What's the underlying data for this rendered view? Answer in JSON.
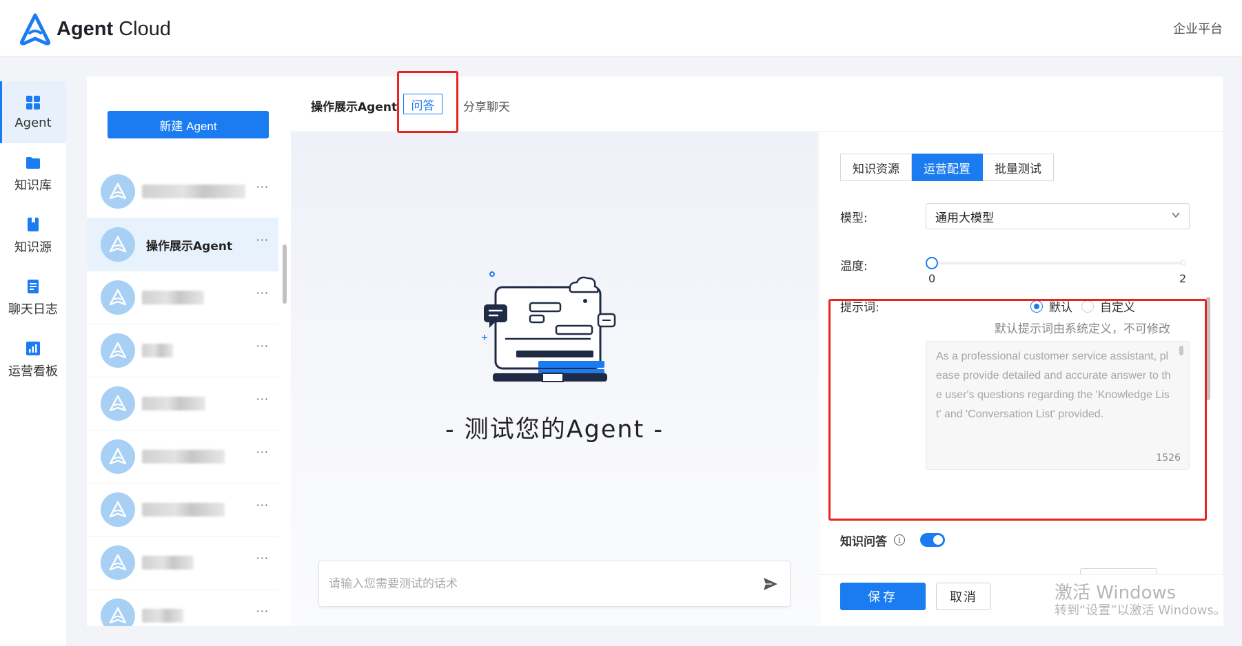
{
  "app": {
    "brand_bold": "Agent",
    "brand_light": "Cloud",
    "enterprise_label": "企业平台"
  },
  "nav": {
    "items": [
      {
        "label": "Agent",
        "icon": "grid-icon",
        "active": true
      },
      {
        "label": "知识库",
        "icon": "folder-icon"
      },
      {
        "label": "知识源",
        "icon": "book-icon"
      },
      {
        "label": "聊天日志",
        "icon": "doc-icon"
      },
      {
        "label": "运营看板",
        "icon": "chart-icon"
      }
    ]
  },
  "agent_list": {
    "new_button": "新建 Agent",
    "items": [
      {
        "name": "",
        "more": "···"
      },
      {
        "name": "操作展示Agent",
        "more": "···",
        "active": true
      },
      {
        "name": "",
        "more": "···"
      },
      {
        "name": "",
        "more": "···"
      },
      {
        "name": "",
        "more": "···"
      },
      {
        "name": "",
        "more": "···"
      },
      {
        "name": "",
        "more": "···"
      },
      {
        "name": "",
        "more": "···"
      },
      {
        "name": "",
        "more": "···"
      }
    ]
  },
  "topbar": {
    "title": "操作展示Agent",
    "tab_qa": "问答",
    "tab_share": "分享聊天"
  },
  "chat": {
    "title": "- 测试您的Agent -",
    "placeholder": "请输入您需要测试的话术"
  },
  "config": {
    "tabs": [
      "知识资源",
      "运营配置",
      "批量测试"
    ],
    "active_tab": "运营配置",
    "model_label": "模型:",
    "model_value": "通用大模型",
    "temperature_label": "温度:",
    "temperature_min": "0",
    "temperature_max": "2",
    "temperature_value": 0,
    "prompt_label": "提示词:",
    "radio_default": "默认",
    "radio_custom": "自定义",
    "prompt_hint": "默认提示词由系统定义，不可修改",
    "prompt_text": "As a professional customer service assistant, please provide detailed and accurate answer to the user's questions regarding the 'Knowledge List' and 'Conversation List' provided.",
    "prompt_count": "1526",
    "kb_qa_label": "知识问答",
    "kb_qa_enabled": true,
    "save_label": "保存",
    "cancel_label": "取消"
  },
  "watermark": {
    "line1": "激活 Windows",
    "line2": "转到“设置”以激活 Windows。"
  },
  "colors": {
    "accent": "#1a7cf0",
    "highlight": "#e9231f"
  }
}
